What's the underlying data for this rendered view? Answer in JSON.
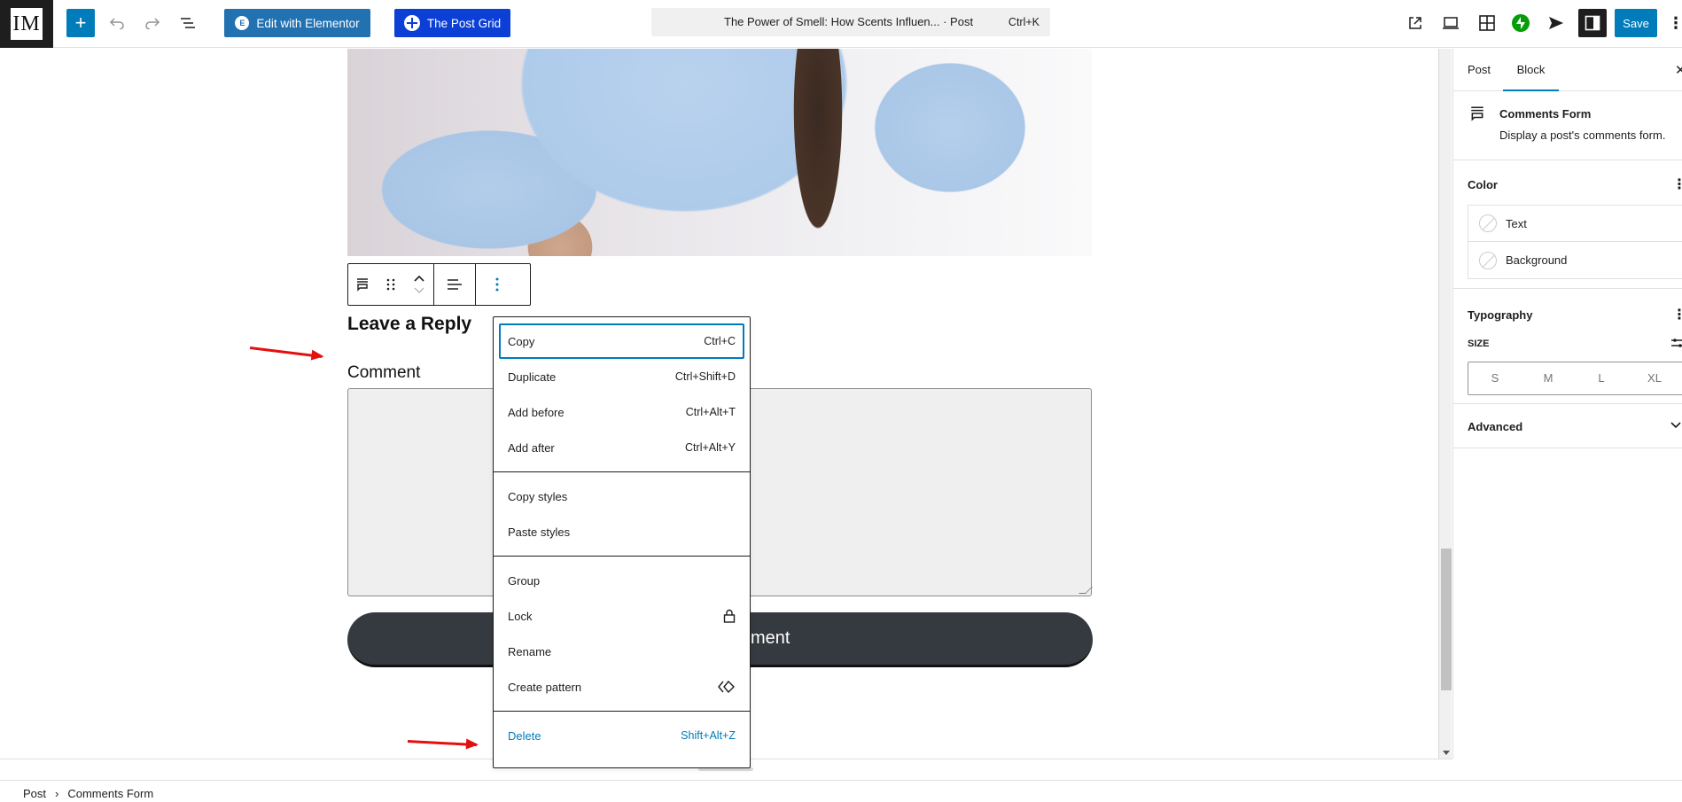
{
  "topbar": {
    "logo_text": "IM",
    "add_block_label": "+",
    "edit_with_elementor": "Edit with Elementor",
    "elementor_icon": "E",
    "post_grid": "The Post Grid",
    "command_bar": {
      "title": "The Power of Smell: How Scents Influen...  · Post",
      "shortcut": "Ctrl+K"
    },
    "save_label": "Save",
    "options_glyph": "⋮"
  },
  "canvas": {
    "reply_title": "Leave a Reply",
    "comment_label": "Comment",
    "submit_visible_text": "ment"
  },
  "block_menu": {
    "sections": [
      [
        {
          "label": "Copy",
          "shortcut": "Ctrl+C"
        },
        {
          "label": "Duplicate",
          "shortcut": "Ctrl+Shift+D"
        },
        {
          "label": "Add before",
          "shortcut": "Ctrl+Alt+T"
        },
        {
          "label": "Add after",
          "shortcut": "Ctrl+Alt+Y"
        }
      ],
      [
        {
          "label": "Copy styles",
          "shortcut": ""
        },
        {
          "label": "Paste styles",
          "shortcut": ""
        }
      ],
      [
        {
          "label": "Group",
          "shortcut": ""
        },
        {
          "label": "Lock",
          "icon": "lock-icon"
        },
        {
          "label": "Rename",
          "shortcut": ""
        },
        {
          "label": "Create pattern",
          "icon": "pattern-icon"
        }
      ],
      [
        {
          "label": "Delete",
          "shortcut": "Shift+Alt+Z"
        }
      ]
    ]
  },
  "sidebar": {
    "tabs": [
      "Post",
      "Block"
    ],
    "active_tab": "Block",
    "close_glyph": "✕",
    "block_card": {
      "name": "Comments Form",
      "description": "Display a post's comments form."
    },
    "color": {
      "title": "Color",
      "items": [
        "Text",
        "Background"
      ]
    },
    "typography": {
      "title": "Typography",
      "size_label": "SIZE",
      "size_options": [
        "S",
        "M",
        "L",
        "XL"
      ]
    },
    "advanced": {
      "title": "Advanced"
    }
  },
  "footer": {
    "breadcrumb": [
      "Post",
      "Comments Form"
    ],
    "separator": "›"
  },
  "colors": {
    "accent": "#007cba",
    "elementor": "#2271b1",
    "post_grid": "#0b3fd6",
    "jetpack": "#069e08",
    "annotation_arrow": "#e41010",
    "submit_button": "#343a3f"
  }
}
